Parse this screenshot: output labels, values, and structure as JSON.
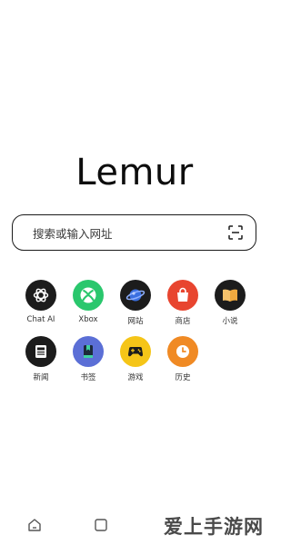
{
  "app": {
    "logo_text": "Lemur"
  },
  "search": {
    "placeholder": "搜索或输入网址",
    "scan_icon": "scan-icon"
  },
  "shortcuts": [
    {
      "label": "Chat AI",
      "icon": "chatgpt-icon",
      "color": "#1c1c1c"
    },
    {
      "label": "Xbox",
      "icon": "xbox-icon",
      "color": "#2ac76d"
    },
    {
      "label": "网站",
      "icon": "planet-icon",
      "color": "#1c1c1c"
    },
    {
      "label": "商店",
      "icon": "shopping-bag-icon",
      "color": "#e8452f"
    },
    {
      "label": "小说",
      "icon": "book-icon",
      "color": "#1c1c1c"
    },
    {
      "label": "新闻",
      "icon": "newspaper-icon",
      "color": "#1c1c1c"
    },
    {
      "label": "书签",
      "icon": "bookmark-icon",
      "color": "#5b6fd6"
    },
    {
      "label": "游戏",
      "icon": "gamepad-icon",
      "color": "#f5c518"
    },
    {
      "label": "历史",
      "icon": "clock-icon",
      "color": "#f08a24"
    }
  ],
  "bottom_bar": {
    "home_icon": "home-icon",
    "tabs_icon": "tabs-icon"
  },
  "watermark": {
    "text": "爱上手游网"
  }
}
